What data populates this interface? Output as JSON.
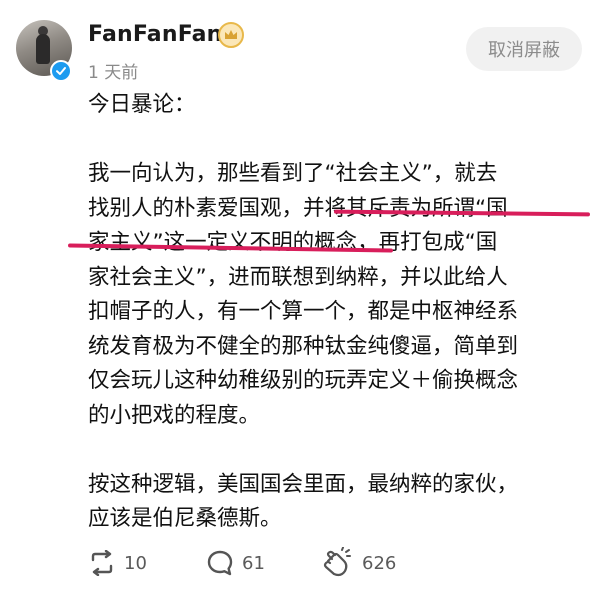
{
  "user": {
    "name": "FanFanFan",
    "time": "1 天前"
  },
  "header": {
    "unblock_label": "取消屏蔽"
  },
  "post": {
    "p1": "今日暴论：",
    "p2_lines": [
      "我一向认为，那些看到了“社会主义”，就去",
      "找别人的朴素爱国观，并将其斥责为所谓“国",
      "家主义”这一定义不明的概念，再打包成“国",
      "家社会主义”，进而联想到纳粹，并以此给人",
      "扣帽子的人，有一个算一个，都是中枢神经系",
      "统发育极为不健全的那种钛金纯傻逼，简单到",
      "仅会玩儿这种幼稚级别的玩弄定义＋偷换概念",
      "的小把戏的程度。"
    ],
    "p3_lines": [
      "按这种逻辑，美国国会里面，最纳粹的家伙，",
      "应该是伯尼桑德斯。"
    ]
  },
  "actions": {
    "repost_count": "10",
    "comment_count": "61",
    "like_count": "626"
  },
  "colors": {
    "underline": "#d81e5b",
    "verified": "#1d9bf0",
    "crown": "#e8b84a"
  },
  "icons": [
    "repost-icon",
    "comment-icon",
    "clap-icon",
    "crown-badge-icon",
    "verified-check-icon"
  ]
}
